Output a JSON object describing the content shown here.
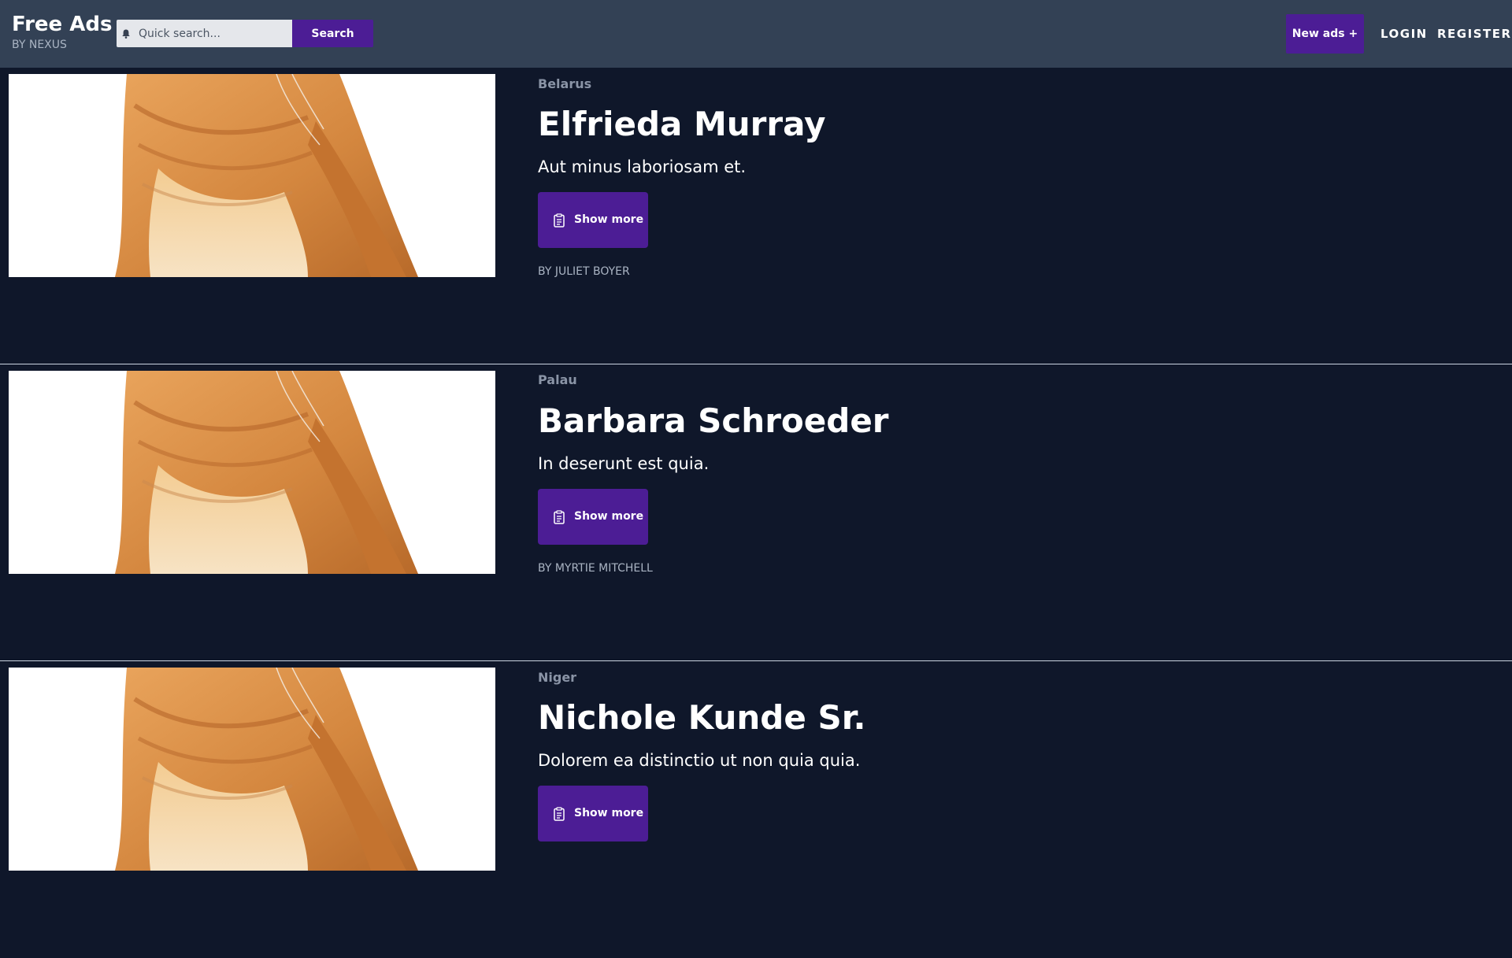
{
  "colors": {
    "header_bg": "#334155",
    "page_bg": "#0f172a",
    "accent": "#4c1d95"
  },
  "header": {
    "brand_title": "Free Ads",
    "brand_subtitle": "BY NEXUS",
    "search_placeholder": "Quick search...",
    "search_value": "",
    "search_button_label": "Search",
    "new_ads_label": "New ads +",
    "login_label": "LOGIN",
    "register_label": "REGISTER"
  },
  "ads": [
    {
      "country": "Belarus",
      "name": "Elfrieda Murray",
      "description": "Aut minus laboriosam et.",
      "button_label": "Show more",
      "author": "BY JULIET BOYER",
      "image_icon": "cat-photo"
    },
    {
      "country": "Palau",
      "name": "Barbara Schroeder",
      "description": "In deserunt est quia.",
      "button_label": "Show more",
      "author": "BY MYRTIE MITCHELL",
      "image_icon": "cat-photo"
    },
    {
      "country": "Niger",
      "name": "Nichole Kunde Sr.",
      "description": "Dolorem ea distinctio ut non quia quia.",
      "button_label": "Show more",
      "author": "",
      "image_icon": "cat-photo"
    }
  ]
}
